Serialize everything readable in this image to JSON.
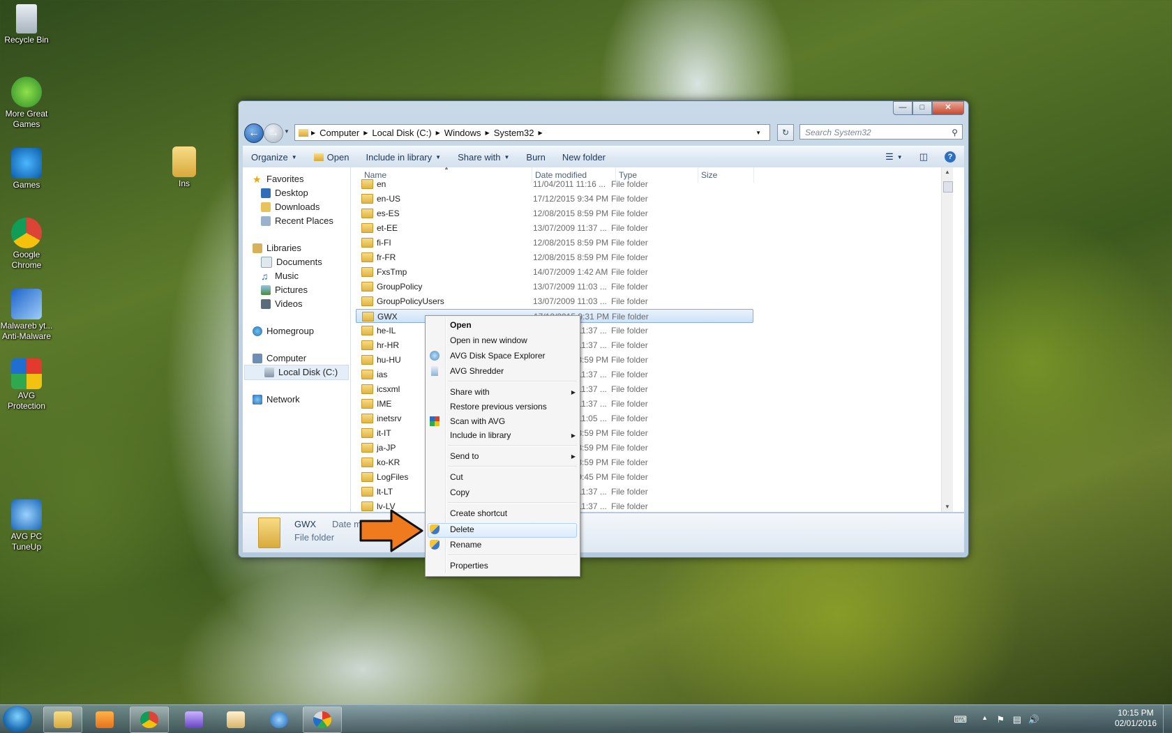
{
  "desktop": {
    "icons": [
      {
        "label": "Recycle Bin"
      },
      {
        "label": "More Great Games"
      },
      {
        "label": "Games"
      },
      {
        "label": "Google Chrome"
      },
      {
        "label": "Malwareb yt... Anti-Malware"
      },
      {
        "label": "AVG Protection"
      },
      {
        "label": "AVG PC TuneUp"
      },
      {
        "label": "Ins"
      }
    ]
  },
  "window": {
    "breadcrumb": [
      "Computer",
      "Local Disk (C:)",
      "Windows",
      "System32"
    ],
    "search_placeholder": "Search System32",
    "toolbar": {
      "organize": "Organize",
      "open": "Open",
      "include_in_library": "Include in library",
      "share_with": "Share with",
      "burn": "Burn",
      "new_folder": "New folder"
    },
    "nav": {
      "favorites": "Favorites",
      "desktop": "Desktop",
      "downloads": "Downloads",
      "recent_places": "Recent Places",
      "libraries": "Libraries",
      "documents": "Documents",
      "music": "Music",
      "pictures": "Pictures",
      "videos": "Videos",
      "homegroup": "Homegroup",
      "computer": "Computer",
      "local_disk": "Local Disk (C:)",
      "network": "Network"
    },
    "columns": {
      "name": "Name",
      "date_modified": "Date modified",
      "type": "Type",
      "size": "Size"
    },
    "rows": [
      {
        "name": "en",
        "date": "11/04/2011 11:16 ...",
        "type": "File folder"
      },
      {
        "name": "en-US",
        "date": "17/12/2015 9:34 PM",
        "type": "File folder"
      },
      {
        "name": "es-ES",
        "date": "12/08/2015 8:59 PM",
        "type": "File folder"
      },
      {
        "name": "et-EE",
        "date": "13/07/2009 11:37 ...",
        "type": "File folder"
      },
      {
        "name": "fi-FI",
        "date": "12/08/2015 8:59 PM",
        "type": "File folder"
      },
      {
        "name": "fr-FR",
        "date": "12/08/2015 8:59 PM",
        "type": "File folder"
      },
      {
        "name": "FxsTmp",
        "date": "14/07/2009 1:42 AM",
        "type": "File folder"
      },
      {
        "name": "GroupPolicy",
        "date": "13/07/2009 11:03 ...",
        "type": "File folder"
      },
      {
        "name": "GroupPolicyUsers",
        "date": "13/07/2009 11:03 ...",
        "type": "File folder"
      },
      {
        "name": "GWX",
        "date": "17/12/2015 9:31 PM",
        "type": "File folder"
      },
      {
        "name": "he-IL",
        "date": "13/07/2009 11:37 ...",
        "type": "File folder"
      },
      {
        "name": "hr-HR",
        "date": "13/07/2009 11:37 ...",
        "type": "File folder"
      },
      {
        "name": "hu-HU",
        "date": "12/08/2015 8:59 PM",
        "type": "File folder"
      },
      {
        "name": "ias",
        "date": "13/07/2009 11:37 ...",
        "type": "File folder"
      },
      {
        "name": "icsxml",
        "date": "13/07/2009 11:37 ...",
        "type": "File folder"
      },
      {
        "name": "IME",
        "date": "13/07/2009 11:37 ...",
        "type": "File folder"
      },
      {
        "name": "inetsrv",
        "date": "13/07/2009 11:05 ...",
        "type": "File folder"
      },
      {
        "name": "it-IT",
        "date": "12/08/2015 8:59 PM",
        "type": "File folder"
      },
      {
        "name": "ja-JP",
        "date": "12/08/2015 8:59 PM",
        "type": "File folder"
      },
      {
        "name": "ko-KR",
        "date": "12/08/2015 8:59 PM",
        "type": "File folder"
      },
      {
        "name": "LogFiles",
        "date": "17/12/2015 9:45 PM",
        "type": "File folder"
      },
      {
        "name": "lt-LT",
        "date": "13/07/2009 11:37 ...",
        "type": "File folder"
      },
      {
        "name": "lv-LV",
        "date": "13/07/2009 11:37 ...",
        "type": "File folder"
      }
    ],
    "details": {
      "name": "GWX",
      "type": "File folder",
      "date_label": "Date m"
    }
  },
  "context_menu": {
    "open": "Open",
    "open_new_window": "Open in new window",
    "avg_disk_space": "AVG Disk Space Explorer",
    "avg_shredder": "AVG Shredder",
    "share_with": "Share with",
    "restore_previous": "Restore previous versions",
    "scan_with_avg": "Scan with AVG",
    "include_in_library": "Include in library",
    "send_to": "Send to",
    "cut": "Cut",
    "copy": "Copy",
    "create_shortcut": "Create shortcut",
    "delete": "Delete",
    "rename": "Rename",
    "properties": "Properties"
  },
  "taskbar": {
    "time": "10:15 PM",
    "date": "02/01/2016"
  }
}
